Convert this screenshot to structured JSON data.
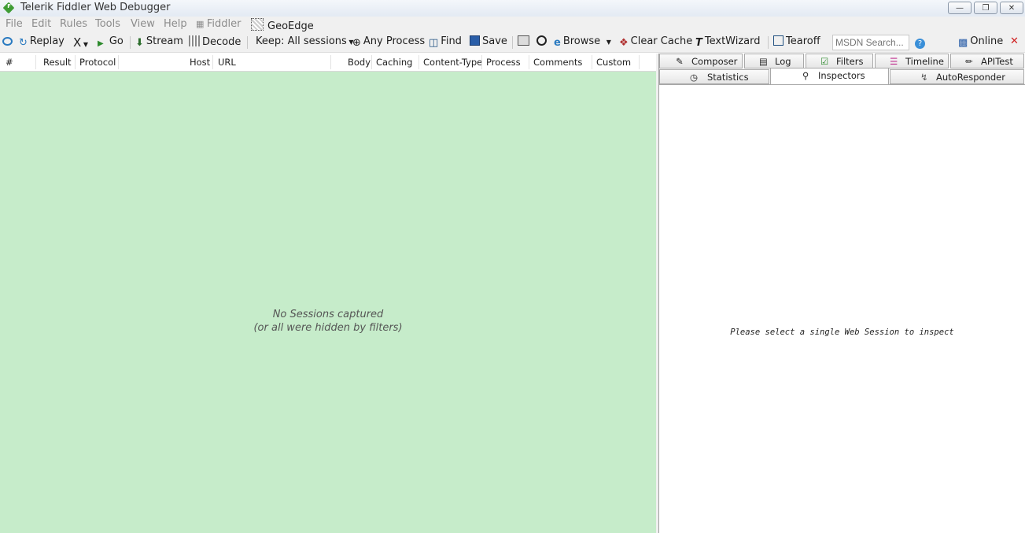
{
  "window": {
    "title": "Telerik Fiddler Web Debugger",
    "app_icon_letter": "F"
  },
  "menu": [
    "File",
    "Edit",
    "Rules",
    "Tools",
    "View",
    "Help",
    "Fiddler",
    "GeoEdge"
  ],
  "toolbar": {
    "replay": "Replay",
    "remove": "X",
    "go": "Go",
    "stream": "Stream",
    "decode": "Decode",
    "keep": "Keep: All sessions",
    "process": "Any Process",
    "find": "Find",
    "save": "Save",
    "browse": "Browse",
    "clear_cache": "Clear Cache",
    "textwizard": "TextWizard",
    "tearoff": "Tearoff",
    "search_placeholder": "MSDN Search...",
    "online": "Online"
  },
  "columns": [
    "#",
    "Result",
    "Protocol",
    "Host",
    "URL",
    "Body",
    "Caching",
    "Content-Type",
    "Process",
    "Comments",
    "Custom"
  ],
  "sessions": {
    "empty_line1": "No Sessions captured",
    "empty_line2": "(or all were hidden by filters)"
  },
  "tabs_row1": [
    "Composer",
    "Log",
    "Filters",
    "Timeline",
    "APITest"
  ],
  "tabs_row2": [
    "Statistics",
    "Inspectors",
    "AutoResponder"
  ],
  "active_tab": "Inspectors",
  "inspectors": {
    "message": "Please select a single Web Session to inspect"
  },
  "colors": {
    "session_bg": "#c6ecca",
    "chrome_bg": "#f0f0f0"
  }
}
